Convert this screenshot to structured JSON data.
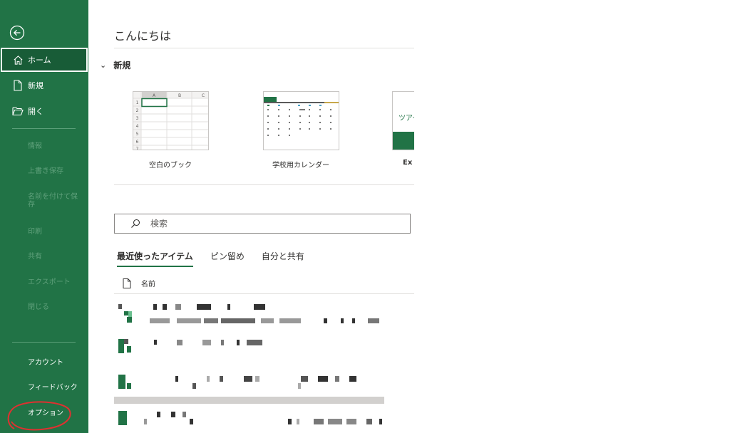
{
  "sidebar": {
    "back_label": "",
    "items": [
      {
        "label": "ホーム",
        "icon": "home-icon"
      },
      {
        "label": "新規",
        "icon": "new-doc-icon"
      },
      {
        "label": "開く",
        "icon": "open-folder-icon"
      }
    ],
    "disabled_items": [
      "情報",
      "上書き保存",
      "名前を付けて保存",
      "印刷",
      "共有",
      "エクスポート",
      "閉じる"
    ],
    "bottom_items": [
      "アカウント",
      "フィードバック",
      "オプション"
    ]
  },
  "main": {
    "greeting": "こんにちは",
    "new_section": {
      "title": "新規",
      "templates": [
        {
          "name": "空白のブック"
        },
        {
          "name": "学校用カレンダー"
        },
        {
          "name": "Ex",
          "thumb_text": "ツアー"
        }
      ],
      "blank_grid": {
        "columns": [
          "A",
          "B",
          "C"
        ],
        "rows": [
          "1",
          "2",
          "3",
          "4",
          "5",
          "6",
          "7"
        ]
      }
    },
    "search": {
      "placeholder": "検索"
    },
    "tabs": [
      {
        "label": "最近使ったアイテム",
        "active": true
      },
      {
        "label": "ピン留め",
        "active": false
      },
      {
        "label": "自分と共有",
        "active": false
      }
    ],
    "list": {
      "name_header": "名前"
    }
  },
  "colors": {
    "brand_green": "#217346",
    "selected_green": "#185c37",
    "annotation_red": "#e03030"
  }
}
